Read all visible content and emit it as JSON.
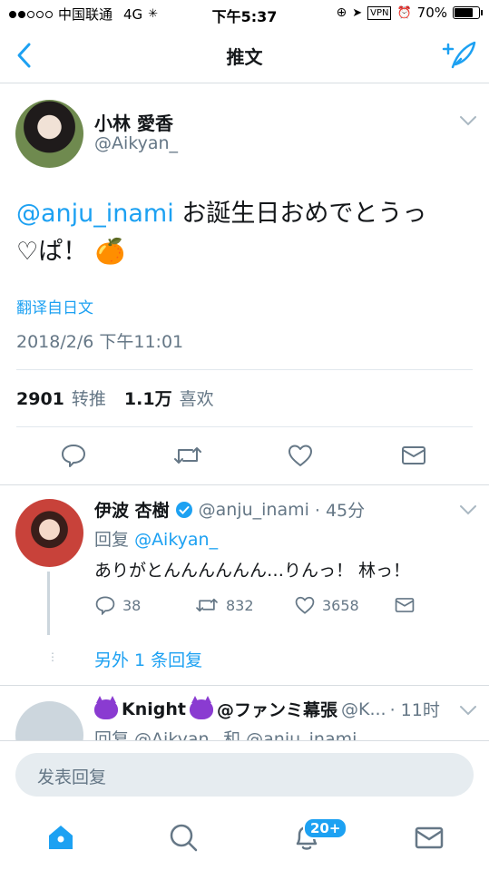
{
  "status_bar": {
    "carrier": "中国联通",
    "network": "4G",
    "time": "下午5:37",
    "vpn": "VPN",
    "battery": "70%",
    "battery_level": 0.7
  },
  "nav": {
    "title": "推文",
    "back_icon": "chevron-left-icon",
    "compose_icon": "compose-tweet-icon"
  },
  "tweet": {
    "author_name": "小林 愛香",
    "author_handle": "@Aikyan_",
    "mention": "@anju_inami",
    "text_line1_rest": " お誕生日おめでとうっ",
    "text_line2": "♡ぱ！ 🍊",
    "translate_label": "翻译自日文",
    "timestamp": "2018/2/6 下午11:01",
    "retweet_count": "2901",
    "retweet_label": "转推",
    "like_count": "1.1万",
    "like_label": "喜欢"
  },
  "reply": {
    "name": "伊波 杏樹",
    "handle": "@anju_inami",
    "time": "· 45分",
    "reply_to_prefix": "回复",
    "reply_to_handle": "@Aikyan_",
    "text": "ありがとんんんんんん…りんっ！ 林っ！",
    "reply_count": "38",
    "retweet_count": "832",
    "like_count": "3658",
    "more_replies": "另外 1 条回复"
  },
  "next_reply": {
    "name": "Knight",
    "name_suffix": "@ファンミ幕張",
    "handle": "@K...",
    "time": "· 11时",
    "reply_to": "回复 @Aikyan_ 和 @anju_inami"
  },
  "reply_box": {
    "placeholder": "发表回复"
  },
  "tab_bar": {
    "tabs": [
      "home-icon",
      "search-icon",
      "notifications-icon",
      "messages-icon"
    ],
    "notifications_badge": "20+"
  },
  "colors": {
    "accent": "#1da1f2",
    "secondary_text": "#657786",
    "divider": "#e1e8ed"
  }
}
